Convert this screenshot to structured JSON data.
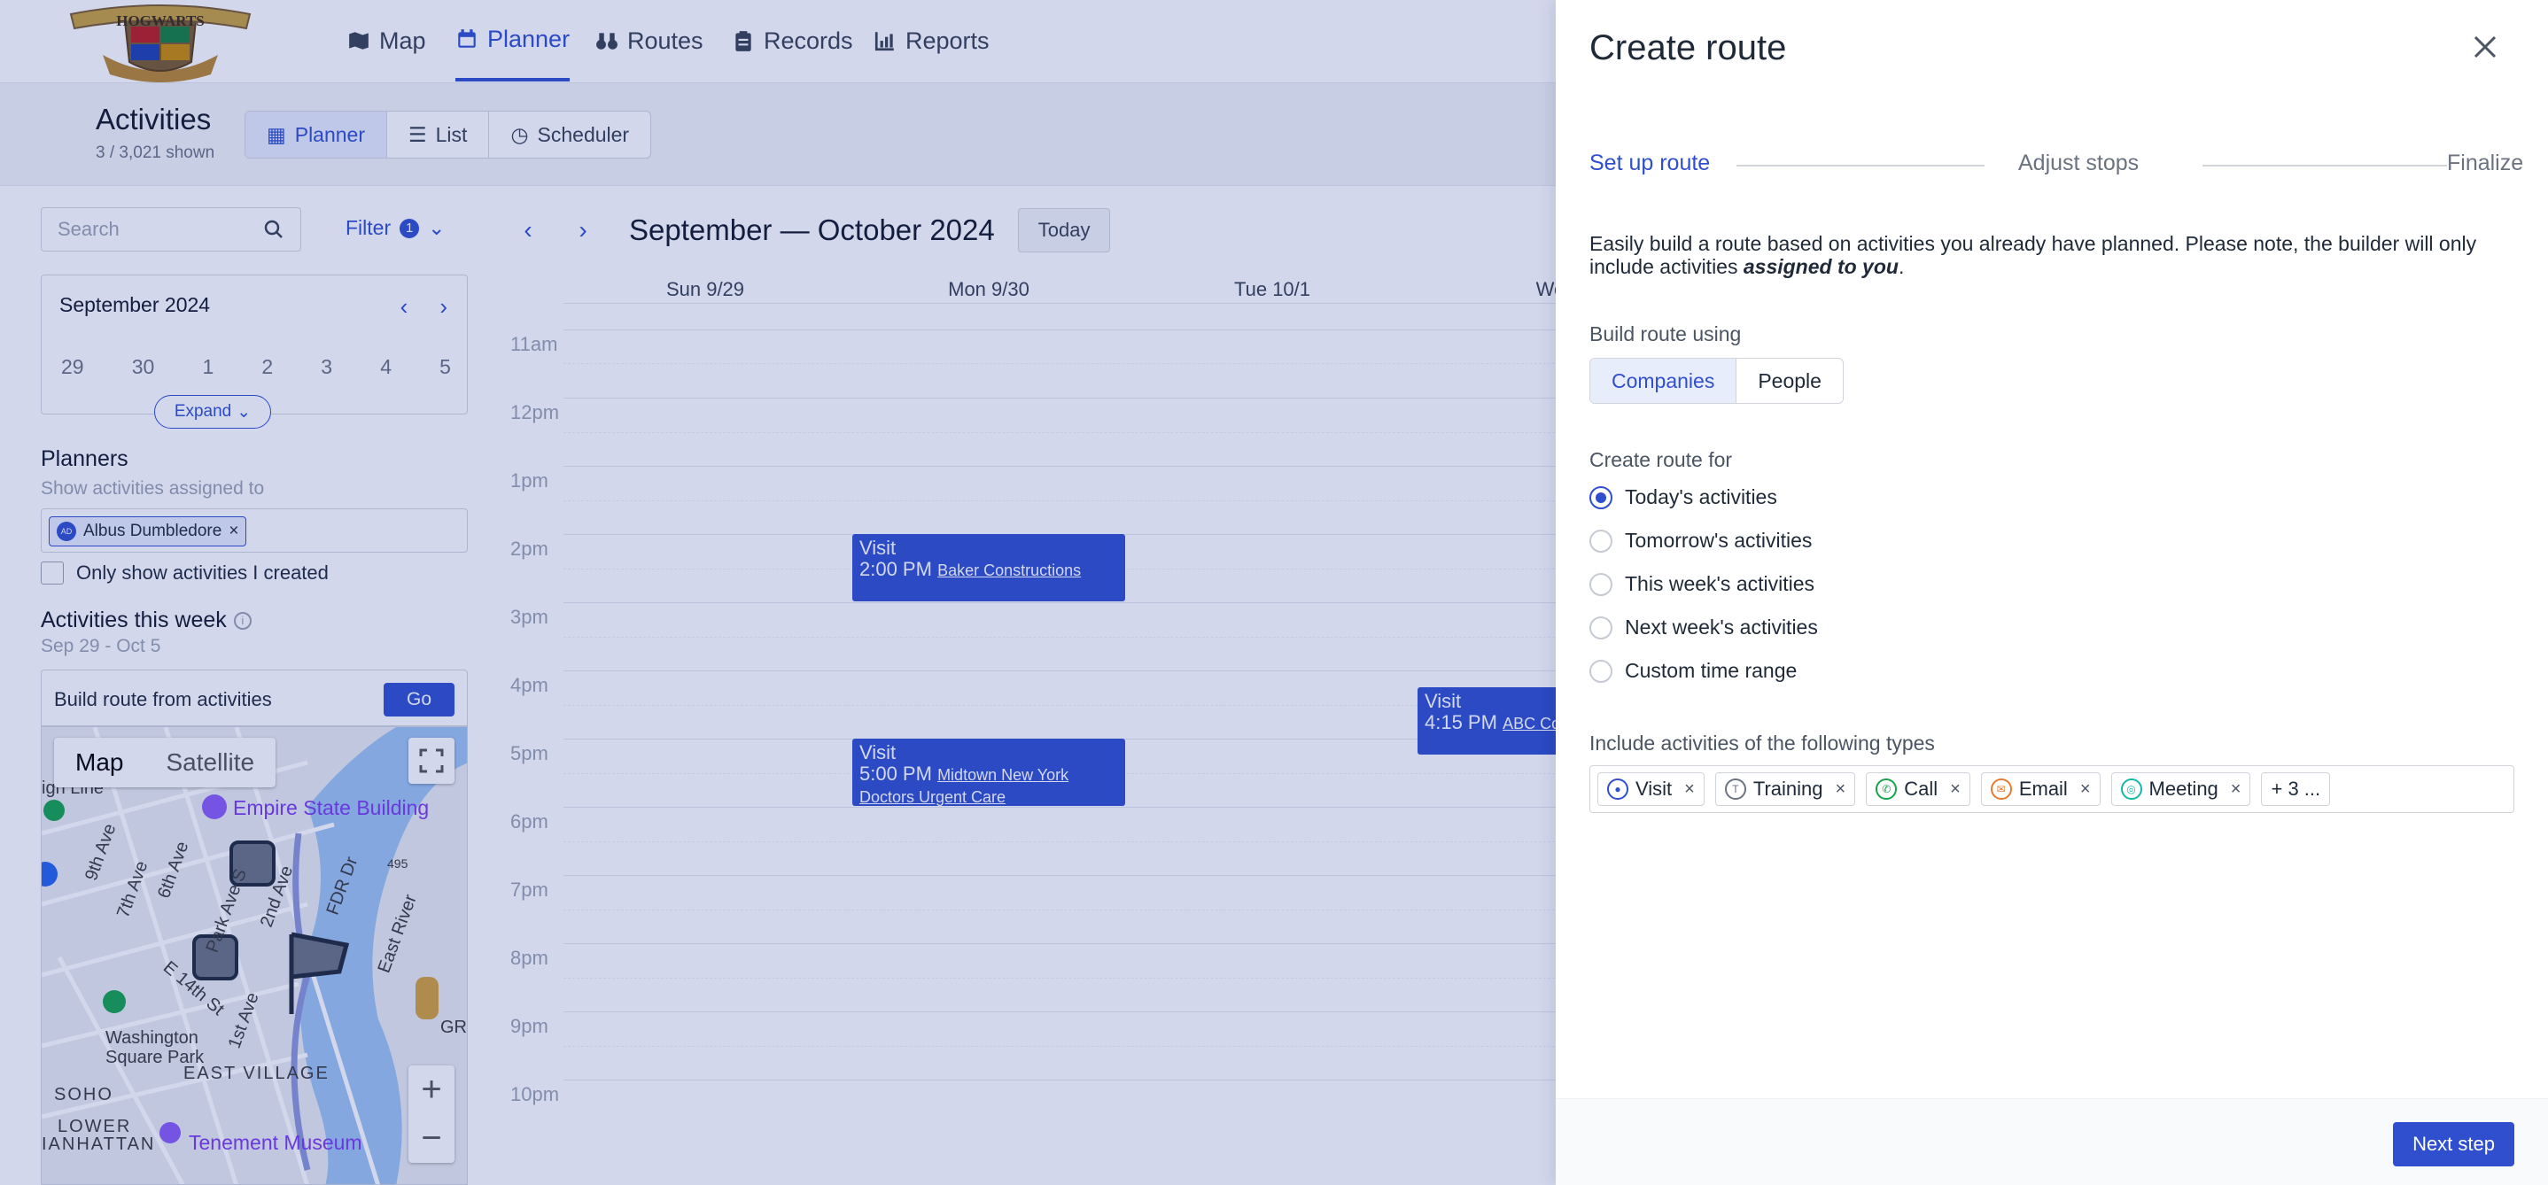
{
  "nav": {
    "logo_text": "HOGWARTS",
    "items": [
      {
        "label": "Map",
        "icon": "map-icon"
      },
      {
        "label": "Planner",
        "icon": "calendar-icon",
        "active": true
      },
      {
        "label": "Routes",
        "icon": "binoculars-icon"
      },
      {
        "label": "Records",
        "icon": "clipboard-icon"
      },
      {
        "label": "Reports",
        "icon": "chart-icon"
      }
    ]
  },
  "subbar": {
    "title": "Activities",
    "count": "3 / 3,021 shown",
    "tabs": [
      {
        "label": "Planner",
        "icon": "calendar-icon",
        "active": true
      },
      {
        "label": "List",
        "icon": "list-icon"
      },
      {
        "label": "Scheduler",
        "icon": "clock-icon"
      }
    ]
  },
  "sidebar": {
    "search_placeholder": "Search",
    "filter_label": "Filter",
    "filter_count": "1",
    "minical_month": "September 2024",
    "minical_days": [
      "29",
      "30",
      "1",
      "2",
      "3",
      "4",
      "5"
    ],
    "expand_label": "Expand",
    "planners_title": "Planners",
    "planners_sub": "Show activities assigned to",
    "planner_chip": "Albus Dumbledore",
    "planner_initials": "AD",
    "only_mine_label": "Only show activities I created",
    "week_title": "Activities this week",
    "week_range": "Sep 29 - Oct 5",
    "build_route_label": "Build route from activities",
    "go_label": "Go"
  },
  "map": {
    "types": [
      "Map",
      "Satellite"
    ],
    "labels": {
      "empire": "Empire State Building",
      "washington": "Washington Square Park",
      "east_village": "EAST VILLAGE",
      "soho": "SOHO",
      "lower": "LOWER",
      "manhattan": "IANHATTAN",
      "tenement": "Tenement Museum",
      "nine_ave": "9th Ave",
      "seven_ave": "7th Ave",
      "six_ave": "6th Ave",
      "park_ave": "Park Ave S",
      "second_ave": "2nd Ave",
      "fdr": "FDR Dr",
      "east_river": "East River",
      "e14": "E 14th St",
      "first_ave": "1st Ave",
      "gre": "GRE",
      "high_line": "igh Line",
      "i495": "495"
    }
  },
  "calendar": {
    "range_label": "September — October 2024",
    "today_label": "Today",
    "days": [
      "Sun 9/29",
      "Mon 9/30",
      "Tue 10/1",
      "Wed"
    ],
    "hours": [
      "11am",
      "12pm",
      "1pm",
      "2pm",
      "3pm",
      "4pm",
      "5pm",
      "6pm",
      "7pm",
      "8pm",
      "9pm",
      "10pm"
    ],
    "events": [
      {
        "type": "Visit",
        "time": "2:00 PM",
        "company": "Baker Constructions"
      },
      {
        "type": "Visit",
        "time": "5:00 PM",
        "company": "Midtown New York Doctors Urgent Care"
      },
      {
        "type": "Visit",
        "time": "4:15 PM",
        "company": "ABC Co"
      }
    ]
  },
  "drawer": {
    "title": "Create route",
    "steps": [
      "Set up route",
      "Adjust stops",
      "Finalize"
    ],
    "intro_text": "Easily build a route based on activities you already have planned. Please note, the builder will only include activities ",
    "intro_emphasis": "assigned to you",
    "intro_end": ".",
    "build_using_label": "Build route using",
    "build_using_options": [
      "Companies",
      "People"
    ],
    "create_for_label": "Create route for",
    "create_for_options": [
      {
        "label": "Today's activities",
        "selected": true
      },
      {
        "label": "Tomorrow's activities",
        "selected": false
      },
      {
        "label": "This week's activities",
        "selected": false
      },
      {
        "label": "Next week's activities",
        "selected": false
      },
      {
        "label": "Custom time range",
        "selected": false
      }
    ],
    "types_label": "Include activities of the following types",
    "types": [
      {
        "label": "Visit",
        "color": "#2f4fce",
        "icon": "person-icon"
      },
      {
        "label": "Training",
        "color": "#6b7280",
        "icon": "training-icon"
      },
      {
        "label": "Call",
        "color": "#16a34a",
        "icon": "phone-icon"
      },
      {
        "label": "Email",
        "color": "#ea7a2f",
        "icon": "email-icon"
      },
      {
        "label": "Meeting",
        "color": "#14b8a6",
        "icon": "people-icon"
      }
    ],
    "types_more": "+ 3 ...",
    "next_label": "Next step"
  },
  "colors": {
    "accent": "#2f4fce",
    "scrim": "rgba(31,56,160,0.2)"
  }
}
